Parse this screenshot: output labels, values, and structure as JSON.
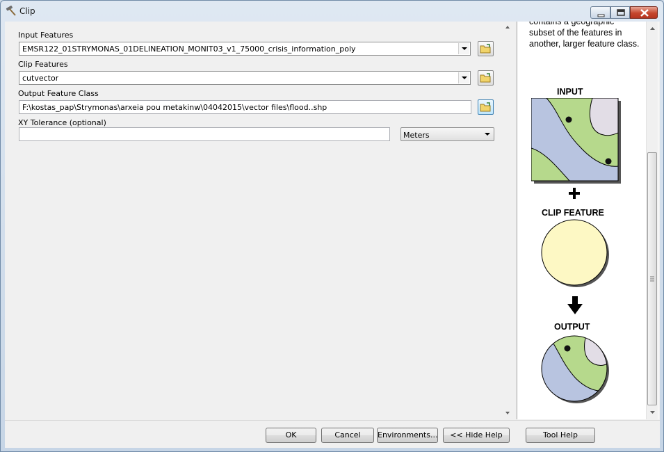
{
  "window": {
    "title": "Clip"
  },
  "form": {
    "input_features": {
      "label": "Input Features",
      "value": "EMSR122_01STRYMONAS_01DELINEATION_MONIT03_v1_75000_crisis_information_poly"
    },
    "clip_features": {
      "label": "Clip Features",
      "value": "cutvector"
    },
    "output_feature_class": {
      "label": "Output Feature Class",
      "value": "F:\\kostas_pap\\Strymonas\\arxeia pou metakinw\\04042015\\vector files\\flood..shp"
    },
    "xy_tolerance": {
      "label": "XY Tolerance (optional)",
      "value": "",
      "unit": "Meters"
    }
  },
  "help": {
    "text": "contains a geographic subset of the features in another, larger feature class.",
    "figure": {
      "input_label": "INPUT",
      "clip_label": "CLIP FEATURE",
      "output_label": "OUTPUT"
    }
  },
  "buttons": {
    "ok": "OK",
    "cancel": "Cancel",
    "environments": "Environments...",
    "hide_help": "<< Hide Help",
    "tool_help": "Tool Help"
  },
  "colors": {
    "map_blue": "#b8c4e0",
    "map_green": "#b6d98c",
    "map_lilac": "#e2dde6",
    "clip_yellow": "#fdf8c4"
  }
}
